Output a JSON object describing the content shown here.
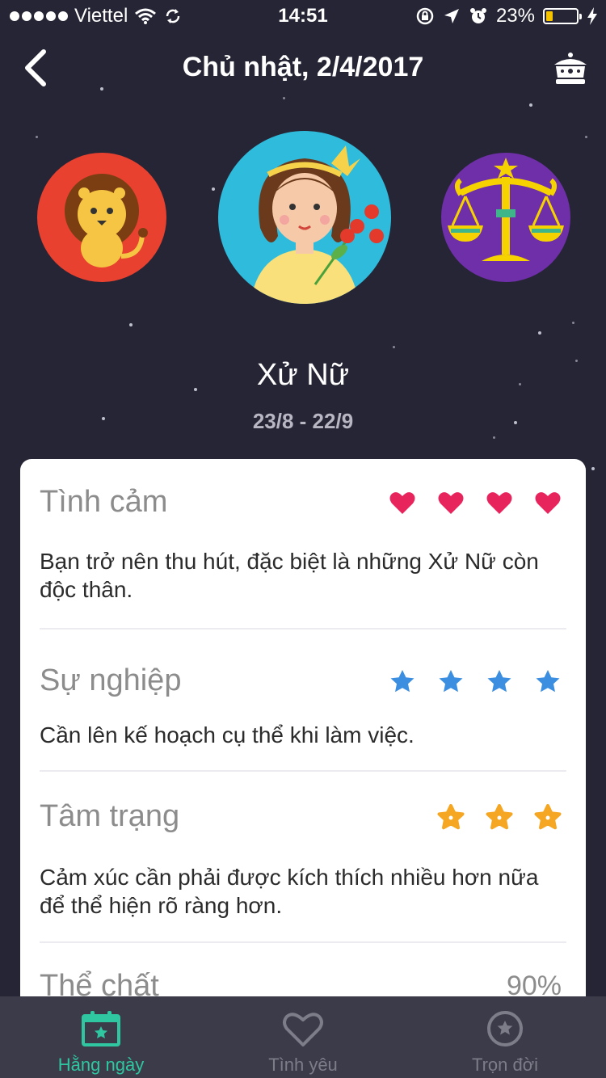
{
  "status_bar": {
    "carrier": "Viettel",
    "time": "14:51",
    "battery_percent": "23%",
    "battery_level": 0.23
  },
  "header": {
    "title": "Chủ nhật, 2/4/2017",
    "back_icon": "chevron-left-icon",
    "premium_icon": "crown-icon"
  },
  "zodiac": {
    "previous": {
      "icon": "leo-lion-icon"
    },
    "current": {
      "icon": "virgo-girl-icon",
      "name": "Xử Nữ",
      "dates": "23/8 - 22/9"
    },
    "next": {
      "icon": "libra-scales-icon"
    }
  },
  "sections": {
    "love": {
      "title": "Tình cảm",
      "rating": 4,
      "rating_icon": "heart-icon",
      "rating_color": "#e8245c",
      "text": "Bạn trở nên thu hút, đặc biệt là những Xử Nữ còn độc thân."
    },
    "career": {
      "title": "Sự nghiệp",
      "rating": 4,
      "rating_icon": "star-icon",
      "rating_color": "#3b8ee0",
      "text": "Cần lên kế hoạch cụ thể khi làm việc."
    },
    "mood": {
      "title": "Tâm trạng",
      "rating": 3,
      "rating_icon": "flower-star-icon",
      "rating_color": "#f5a623",
      "text": "Cảm xúc cần phải được kích thích nhiều hơn nữa để thể hiện rõ ràng hơn."
    },
    "health": {
      "title": "Thể chất",
      "value": "90%"
    }
  },
  "tabs": [
    {
      "label": "Hằng ngày",
      "icon": "calendar-star-icon",
      "active": true
    },
    {
      "label": "Tình yêu",
      "icon": "heart-outline-icon",
      "active": false
    },
    {
      "label": "Trọn đời",
      "icon": "star-circle-icon",
      "active": false
    }
  ],
  "colors": {
    "background": "#262535",
    "accent": "#2fc7a2",
    "tab_inactive": "#7d7c89"
  }
}
